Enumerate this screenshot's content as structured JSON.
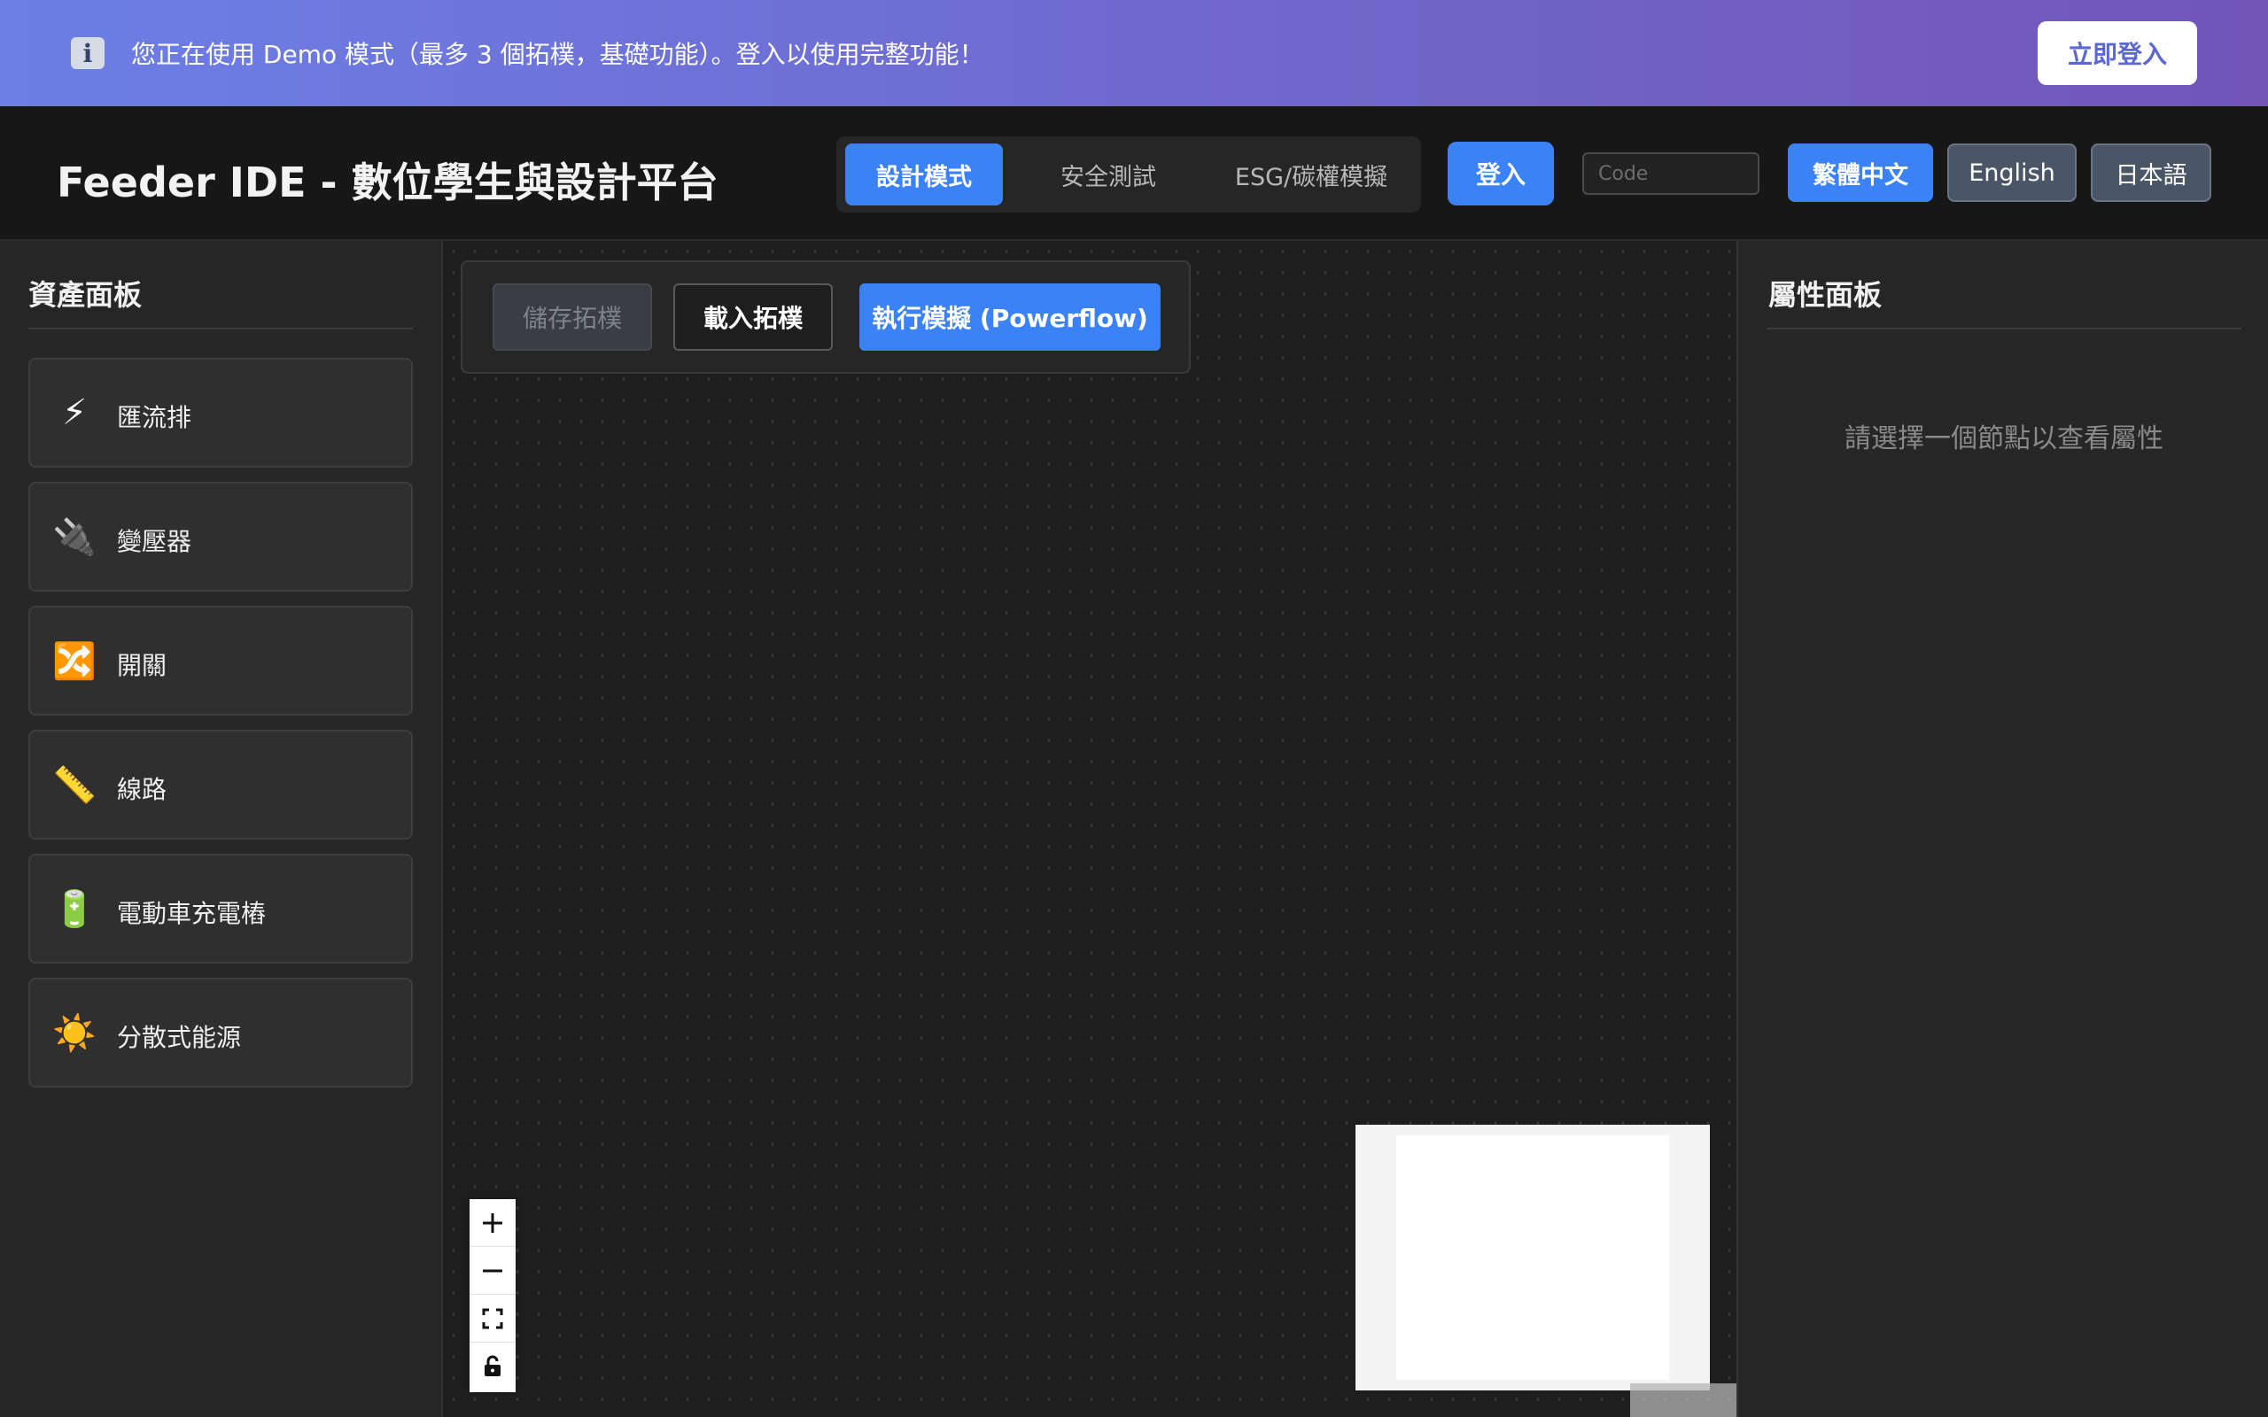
{
  "banner": {
    "icon": "info-icon",
    "icon_glyph": "i",
    "message": "您正在使用 Demo 模式（最多 3 個拓樸，基礎功能）。登入以使用完整功能！",
    "login_label": "立即登入"
  },
  "header": {
    "title": "Feeder IDE - 數位學生與設計平台",
    "modes": [
      {
        "label": "設計模式",
        "active": true
      },
      {
        "label": "安全測試",
        "active": false
      },
      {
        "label": "ESG/碳權模擬",
        "active": false
      }
    ],
    "login_label": "登入",
    "code_placeholder": "Code",
    "code_value": "",
    "languages": [
      {
        "label": "繁體中文",
        "active": true
      },
      {
        "label": "English",
        "active": false
      },
      {
        "label": "日本語",
        "active": false
      }
    ]
  },
  "asset_panel": {
    "title": "資產面板",
    "items": [
      {
        "label": "匯流排",
        "icon": "lightning-icon",
        "glyph": "⚡"
      },
      {
        "label": "變壓器",
        "icon": "plug-icon",
        "glyph": "🔌"
      },
      {
        "label": "開關",
        "icon": "shuffle-icon",
        "glyph": "🔀"
      },
      {
        "label": "線路",
        "icon": "ruler-icon",
        "glyph": "📏"
      },
      {
        "label": "電動車充電樁",
        "icon": "battery-icon",
        "glyph": "🔋"
      },
      {
        "label": "分散式能源",
        "icon": "sun-icon",
        "glyph": "☀️"
      }
    ]
  },
  "toolbar": {
    "save_label": "儲存拓樸",
    "load_label": "載入拓樸",
    "run_label": "執行模擬 (Powerflow)"
  },
  "zoom_controls": [
    {
      "name": "zoom-in-icon",
      "glyph": "+"
    },
    {
      "name": "zoom-out-icon",
      "glyph": "−"
    },
    {
      "name": "fit-view-icon",
      "glyph": "⛶"
    },
    {
      "name": "lock-icon",
      "glyph": "🔓"
    }
  ],
  "property_panel": {
    "title": "屬性面板",
    "empty_message": "請選擇一個節點以查看屬性"
  },
  "colors": {
    "accent": "#3b82f6",
    "banner_start": "#6c7fe6",
    "banner_end": "#7355b8",
    "background": "#1e1e1e"
  }
}
